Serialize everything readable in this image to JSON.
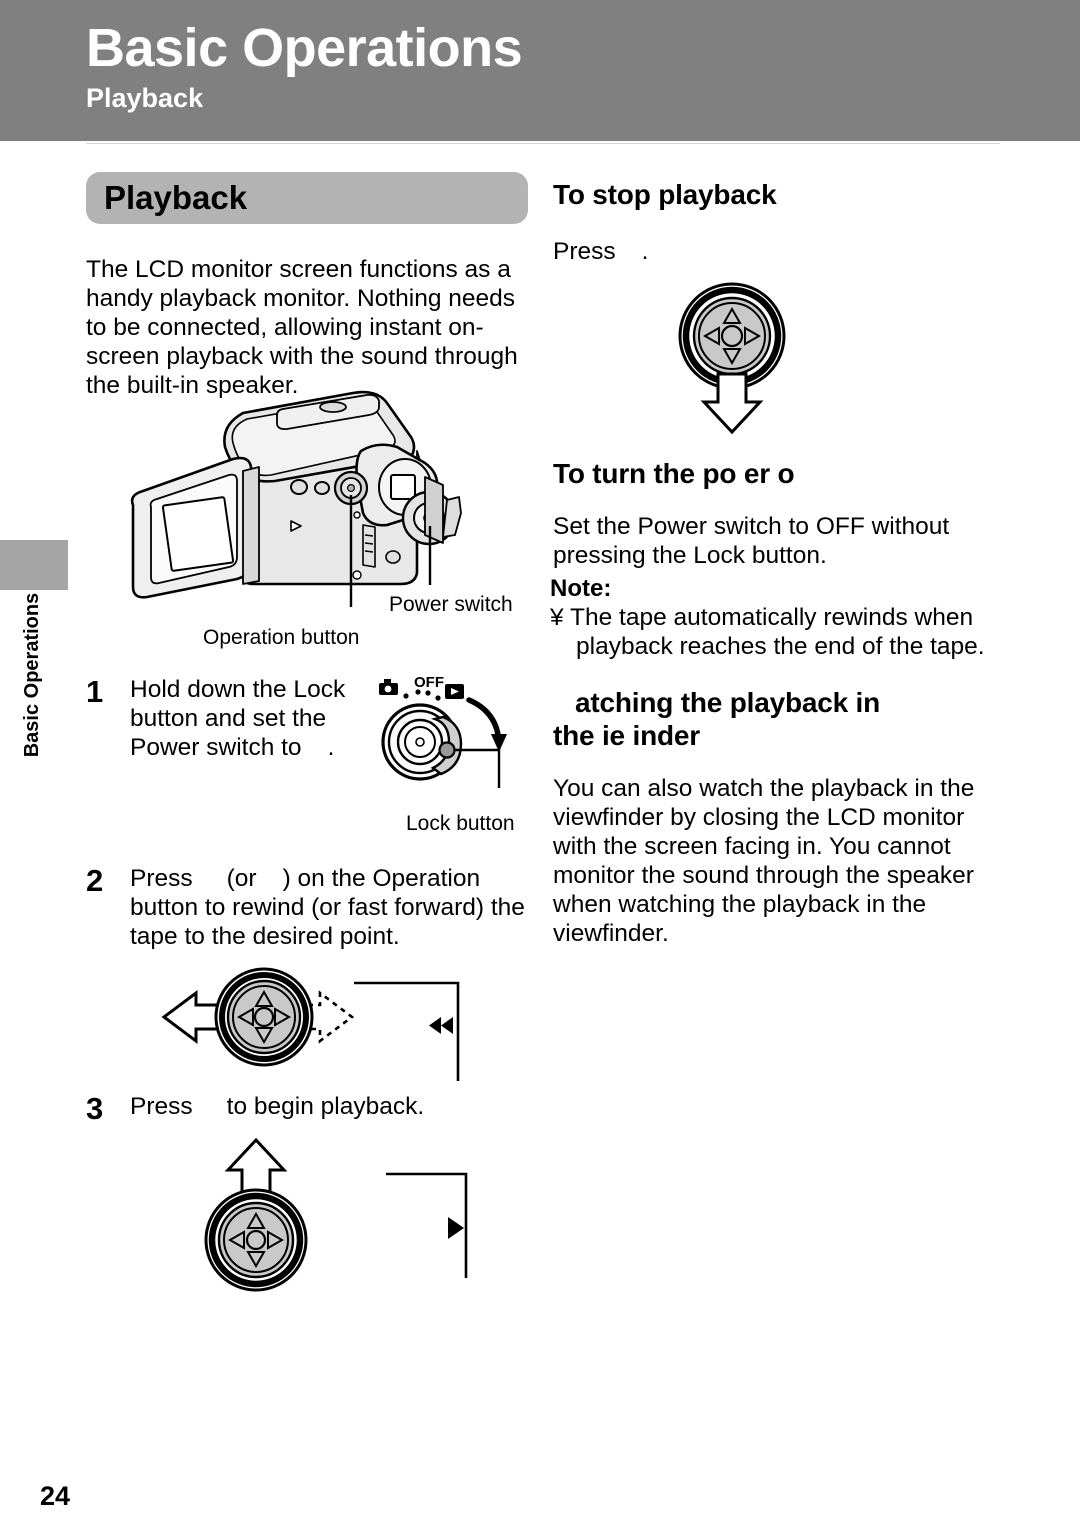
{
  "header": {
    "title": "Basic Operations",
    "subtitle": "Playback"
  },
  "side_tab": {
    "label": "Basic Operations"
  },
  "left_column": {
    "section_title": "Playback",
    "intro_paragraph": "The LCD monitor screen functions as a handy playback monitor. Nothing needs to be connected, allowing instant on-screen playback with the sound through the built-in speaker.",
    "camcorder_figure": {
      "power_switch_label": "Power switch",
      "operation_button_label": "Operation button"
    },
    "steps": [
      {
        "number": "1",
        "text_before": "Hold down the Lock button and set the Power switch to",
        "text_after": ".",
        "figure": {
          "dial_icon_camera": "camera-icon",
          "dial_label_off": "OFF",
          "dial_icon_play": "play-box-icon",
          "lock_button_label": "Lock button"
        }
      },
      {
        "number": "2",
        "text_before": "Press",
        "text_middle": "(or",
        "text_after": ") on the Operation button to rewind (or fast forward) the tape to the desired point.",
        "figure": {
          "callout_icon": "rewind-icon"
        }
      },
      {
        "number": "3",
        "text_before": "Press",
        "text_after": "to begin playback.",
        "figure": {
          "callout_icon": "play-icon"
        }
      }
    ]
  },
  "right_column": {
    "stop_playback": {
      "heading": "To stop playback",
      "text_before": "Press",
      "text_after": "."
    },
    "power_off": {
      "heading": "To turn the po  er o",
      "paragraph": "Set the Power switch to OFF without pressing the Lock button."
    },
    "note": {
      "title": "Note:",
      "bullet": "¥",
      "items": [
        "The tape automatically rewinds when playback reaches the end of the tape."
      ]
    },
    "viewfinder": {
      "heading_line1": "atching the playback in",
      "heading_line2": "the  ie  inder",
      "paragraph": "You can also watch the playback in the viewfinder by closing the LCD monitor with the screen facing in. You cannot monitor the sound through the speaker when watching the playback in the viewfinder."
    }
  },
  "footer": {
    "page_number": "24"
  },
  "colors": {
    "header_band": "#808080",
    "section_pill": "#b3b3b3",
    "side_tab": "#a5a5a5",
    "illustration_fill": "#cccccc"
  }
}
